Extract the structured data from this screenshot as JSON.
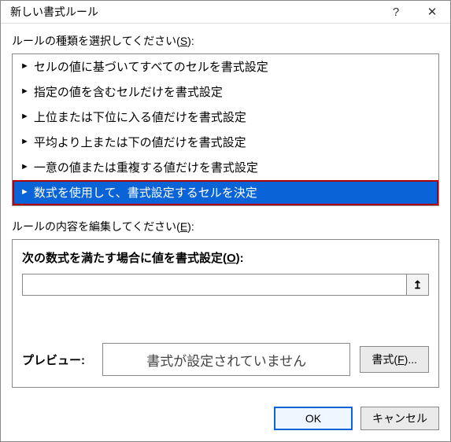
{
  "titlebar": {
    "title": "新しい書式ルール",
    "help": "?",
    "close": "✕"
  },
  "ruleType": {
    "label_prefix": "ルールの種類を選択してください(",
    "label_key": "S",
    "label_suffix": "):",
    "items": [
      "セルの値に基づいてすべてのセルを書式設定",
      "指定の値を含むセルだけを書式設定",
      "上位または下位に入る値だけを書式設定",
      "平均より上または下の値だけを書式設定",
      "一意の値または重複する値だけを書式設定",
      "数式を使用して、書式設定するセルを決定"
    ],
    "selectedIndex": 5
  },
  "ruleEdit": {
    "label_prefix": "ルールの内容を編集してください(",
    "label_key": "E",
    "label_suffix": "):",
    "formulaLabel_prefix": "次の数式を満たす場合に値を書式設定(",
    "formulaLabel_key": "O",
    "formulaLabel_suffix": "):",
    "formulaValue": "",
    "picker": "↥",
    "previewLabel": "プレビュー:",
    "previewText": "書式が設定されていません",
    "formatBtn_prefix": "書式(",
    "formatBtn_key": "F",
    "formatBtn_suffix": ")..."
  },
  "footer": {
    "ok": "OK",
    "cancel": "キャンセル"
  }
}
